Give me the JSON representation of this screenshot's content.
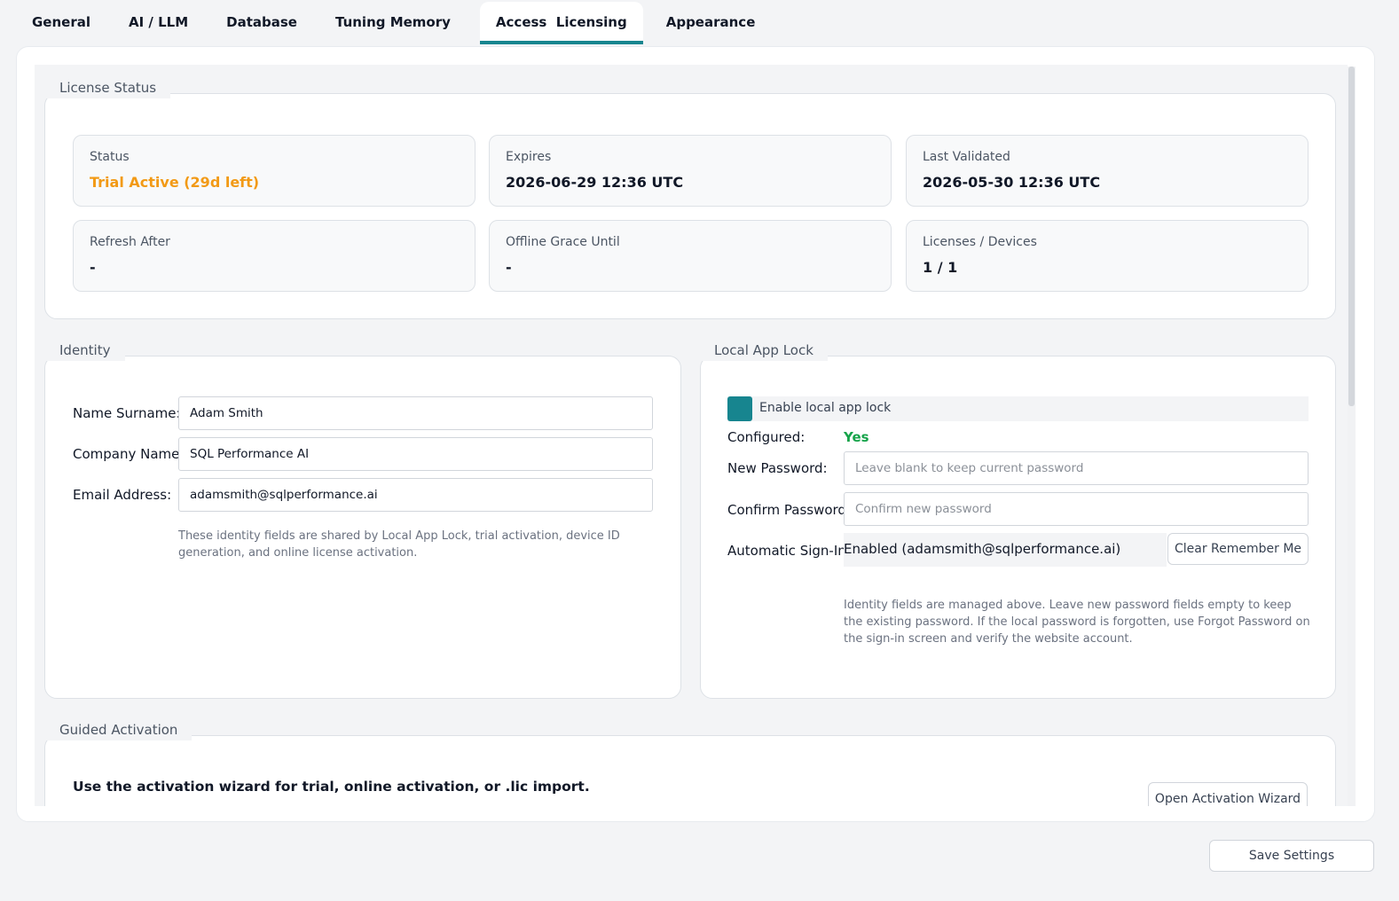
{
  "tabs": [
    {
      "label": "General"
    },
    {
      "label": "AI / LLM"
    },
    {
      "label": "Database"
    },
    {
      "label": "Tuning Memory"
    },
    {
      "label": "Access  Licensing"
    },
    {
      "label": "Appearance"
    }
  ],
  "active_tab": "Access  Licensing",
  "license_status": {
    "title": "License Status",
    "cards": [
      {
        "label": "Status",
        "value": "Trial Active (29d left)",
        "value_color": "#f29a16"
      },
      {
        "label": "Expires",
        "value": "2026-06-29 12:36 UTC"
      },
      {
        "label": "Last Validated",
        "value": "2026-05-30 12:36 UTC"
      },
      {
        "label": "Refresh After",
        "value": "-"
      },
      {
        "label": "Offline Grace Until",
        "value": "-"
      },
      {
        "label": "Licenses / Devices",
        "value": "1 / 1"
      }
    ]
  },
  "identity": {
    "title": "Identity",
    "name_label": "Name Surname:",
    "name_value": "Adam Smith",
    "company_label": "Company Name:",
    "company_value": "SQL Performance AI",
    "email_label": "Email Address:",
    "email_value": "adamsmith@sqlperformance.ai",
    "help": "These identity fields are shared by Local App Lock, trial activation, device ID generation, and online license activation."
  },
  "app_lock": {
    "title": "Local App Lock",
    "enable_label": "Enable local app lock",
    "enabled": true,
    "configured_label": "Configured:",
    "configured_value": "Yes",
    "configured_color": "#16a34a",
    "new_password_label": "New Password:",
    "new_password_placeholder": "Leave blank to keep current password",
    "confirm_password_label": "Confirm Password:",
    "confirm_password_placeholder": "Confirm new password",
    "auto_signin_label": "Automatic Sign-In:",
    "auto_signin_value": "Enabled (adamsmith@sqlperformance.ai)",
    "clear_button": "Clear Remember Me",
    "help": "Identity fields are managed above. Leave new password fields empty to keep the existing password. If the local password is forgotten, use Forgot Password on the sign-in screen and verify the website account."
  },
  "guided_activation": {
    "title": "Guided Activation",
    "description": "Use the activation wizard for trial, online activation, or .lic import.",
    "button": "Open Activation Wizard"
  },
  "footer": {
    "save_button": "Save Settings"
  },
  "colors": {
    "accent": "#17858f",
    "warning": "#f29a16",
    "success": "#16a34a"
  }
}
